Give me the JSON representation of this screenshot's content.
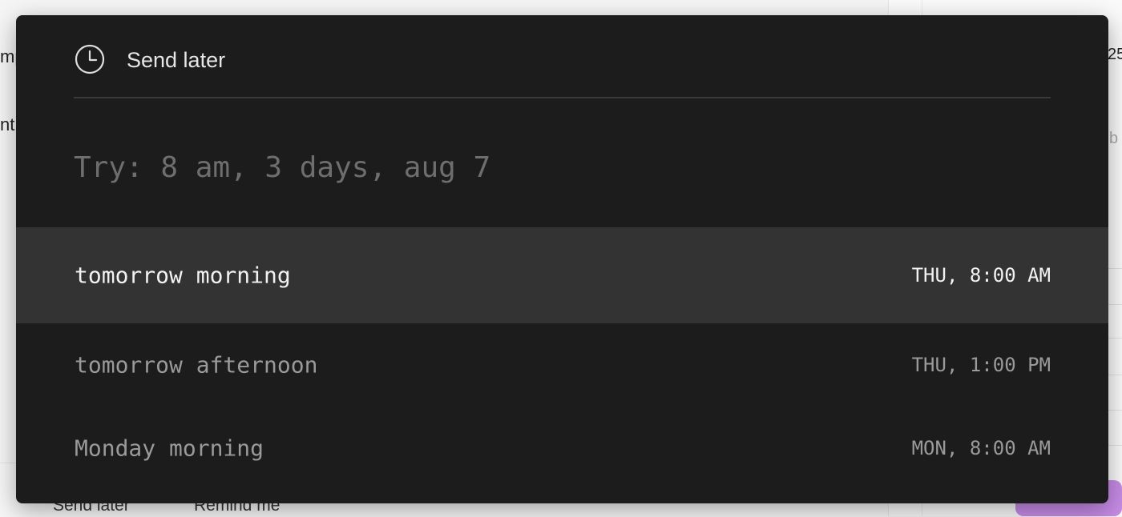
{
  "background": {
    "left_fragments": [
      "mp",
      "nt"
    ],
    "right_fragments": [
      "25",
      "b"
    ],
    "bottom_toolbar": [
      "Send later",
      "Remind me"
    ]
  },
  "modal": {
    "icon": "clock-icon",
    "title": "Send later",
    "input": {
      "value": "",
      "placeholder": "Try: 8 am, 3 days, aug 7"
    },
    "options": [
      {
        "label": "tomorrow morning",
        "time": "THU, 8:00 AM",
        "selected": true
      },
      {
        "label": "tomorrow afternoon",
        "time": "THU, 1:00 PM",
        "selected": false
      },
      {
        "label": "Monday morning",
        "time": "MON, 8:00 AM",
        "selected": false
      }
    ]
  },
  "colors": {
    "modal_background": "#1c1c1c",
    "selected_row": "#333333",
    "accent_purple": "#c78be6"
  }
}
